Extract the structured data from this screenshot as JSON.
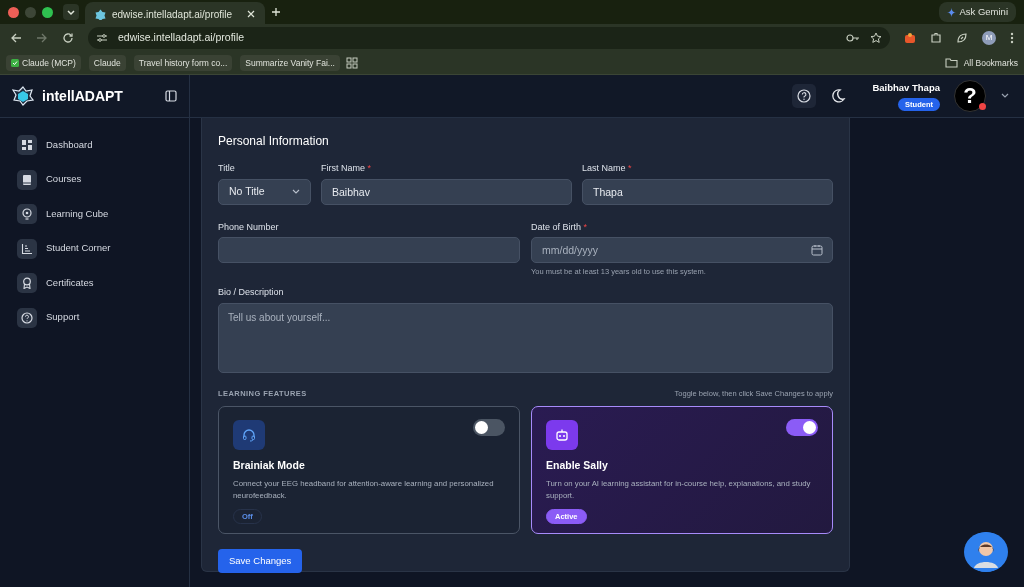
{
  "browser": {
    "tabs": [
      {
        "title": "edwise.intelladapt.ai/profile",
        "selected": true
      }
    ],
    "ask_gemini": "Ask Gemini",
    "address": "edwise.intelladapt.ai/profile",
    "profile_initial": "M",
    "bookmarks": [
      {
        "label": "Claude (MCP)",
        "kind": "check"
      },
      {
        "label": "Claude",
        "kind": "plain"
      },
      {
        "label": "Travel history form co...",
        "kind": "plain"
      },
      {
        "label": "Summarize Vanity Fai...",
        "kind": "plain"
      }
    ],
    "all_bookmarks": "All Bookmarks"
  },
  "app": {
    "brand": "intellADAPT",
    "sidebar": {
      "items": [
        {
          "label": "Dashboard",
          "kind": "grid",
          "selected": false
        },
        {
          "label": "Courses",
          "kind": "book",
          "selected": false
        },
        {
          "label": "Learning Cube",
          "kind": "bulb",
          "selected": false
        },
        {
          "label": "Student Corner",
          "kind": "chart",
          "selected": false
        },
        {
          "label": "Certificates",
          "kind": "award",
          "selected": false
        },
        {
          "label": "Support",
          "kind": "help",
          "selected": false
        }
      ]
    },
    "user": {
      "name": "Baibhav Thapa",
      "role": "Student",
      "avatar_text": "?"
    },
    "personal_information": {
      "title": "Personal Information",
      "title_select": {
        "label": "Title",
        "value": "No Title"
      },
      "first_name": {
        "label": "First Name",
        "required_mark": "*",
        "value": "Baibhav"
      },
      "last_name": {
        "label": "Last Name",
        "required_mark": "*",
        "value": "Thapa"
      },
      "phone_number": {
        "label": "Phone Number"
      },
      "date_of_birth": {
        "label": "Date of Birth",
        "required_mark": "*",
        "placeholder": "mm/dd/yyyy",
        "help": "You must be at least 13 years old to use this system."
      },
      "bio": {
        "label": "Bio / Description",
        "placeholder": "Tell us about yourself..."
      }
    },
    "learning_features": {
      "title": "LEARNING FEATURES",
      "hint": "Toggle below, then click Save Changes to apply",
      "features": [
        {
          "kind": "headset",
          "title": "Brainiak Mode",
          "description": "Connect your EEG headband for attention-aware learning and personalized neurofeedback.",
          "on": false,
          "status": "Off"
        },
        {
          "kind": "robot",
          "title": "Enable Sally",
          "description": "Turn on your AI learning assistant for in-course help, explanations, and study support.",
          "on": true,
          "status": "Active"
        }
      ]
    },
    "save_button": "Save Changes"
  }
}
